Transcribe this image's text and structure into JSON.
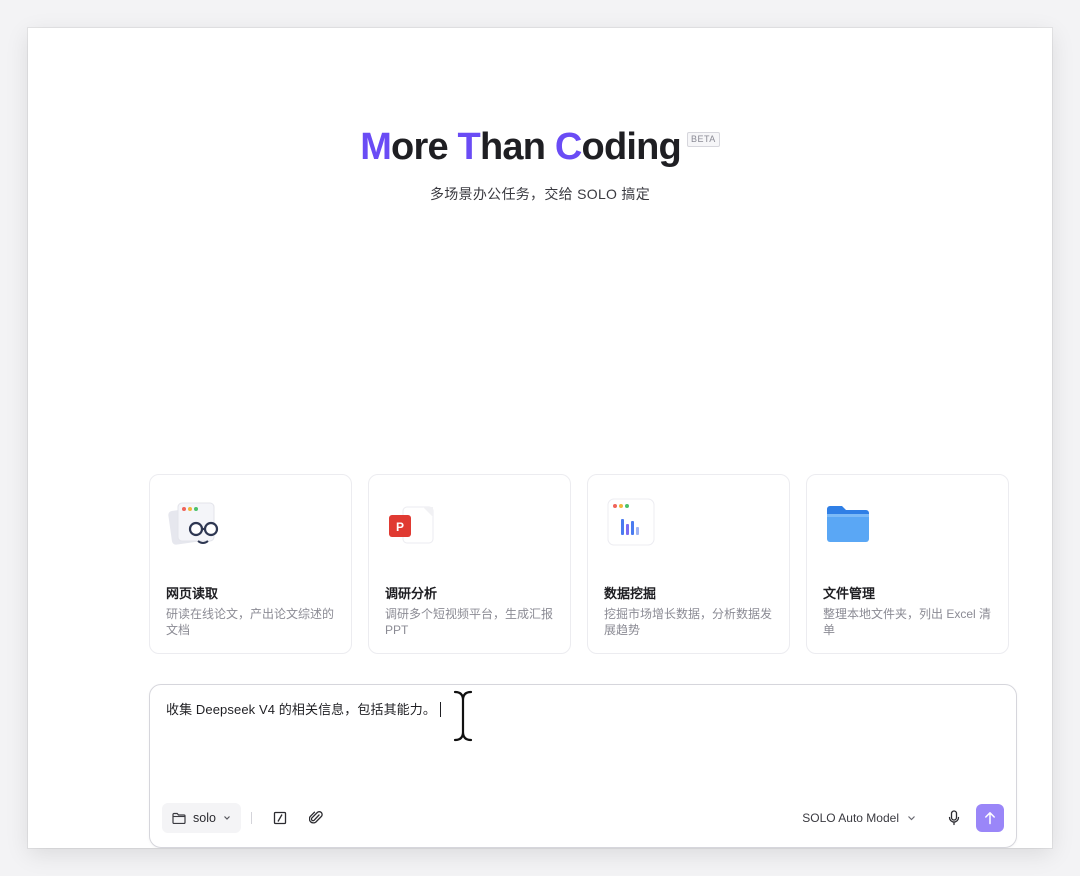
{
  "hero": {
    "title_parts": [
      {
        "text": "M",
        "accent": true
      },
      {
        "text": "ore ",
        "accent": false
      },
      {
        "text": "T",
        "accent": true
      },
      {
        "text": "han ",
        "accent": false
      },
      {
        "text": "C",
        "accent": true
      },
      {
        "text": "oding",
        "accent": false
      }
    ],
    "badge": "BETA",
    "subtitle": "多场景办公任务，交给 SOLO 搞定"
  },
  "cards": [
    {
      "title": "网页读取",
      "desc": "研读在线论文，产出论文综述的文档",
      "icon": "web-reading-glasses-icon"
    },
    {
      "title": "调研分析",
      "desc": "调研多个短视频平台，生成汇报 PPT",
      "icon": "ppt-document-icon"
    },
    {
      "title": "数据挖掘",
      "desc": "挖掘市场增长数据，分析数据发展趋势",
      "icon": "bar-chart-icon"
    },
    {
      "title": "文件管理",
      "desc": "整理本地文件夹，列出 Excel 清单",
      "icon": "folder-icon"
    }
  ],
  "composer": {
    "value": "收集 Deepseek V4 的相关信息，包括其能力。",
    "folder_label": "solo",
    "model_label": "SOLO Auto Model"
  },
  "colors": {
    "accent": "#6a4cf5",
    "send_button": "#9a86f8"
  }
}
